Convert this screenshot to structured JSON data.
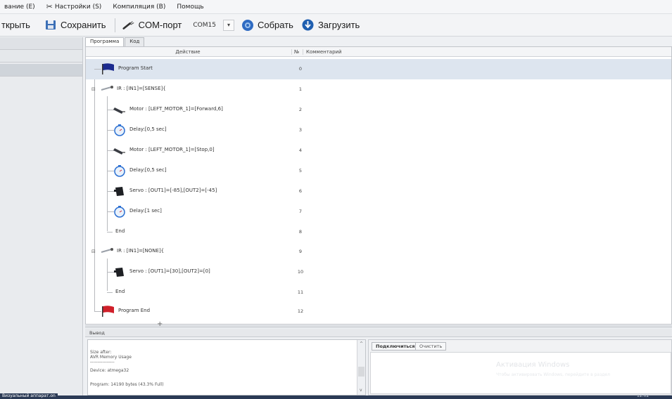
{
  "menu": {
    "edit_label": "вание (E)",
    "settings_label": "Настройки (S)",
    "compile_label": "Компиляция (B)",
    "help_label": "Помощь"
  },
  "toolbar": {
    "open_label": "ткрыть",
    "save_label": "Сохранить",
    "port_label": "COM-порт",
    "port_value": "COM15",
    "build_label": "Собрать",
    "upload_label": "Загрузить"
  },
  "tabs": [
    "Программа",
    "Код"
  ],
  "table": {
    "col_action": "Действие",
    "col_num": "№",
    "col_comment": "Комментарий"
  },
  "program": [
    {
      "label": "Program Start",
      "num": "0",
      "icon": "flag-blue-icon"
    },
    {
      "label": "IR : [IN1]=[SENSE]{",
      "num": "1",
      "icon": "ir-sensor-icon"
    },
    {
      "label": "Motor : [LEFT_MOTOR_1]=[Forward,6]",
      "num": "2",
      "icon": "motor-icon"
    },
    {
      "label": "Delay:[0,5 sec]",
      "num": "3",
      "icon": "stopwatch-icon"
    },
    {
      "label": "Motor : [LEFT_MOTOR_1]=[Stop,0]",
      "num": "4",
      "icon": "motor-icon"
    },
    {
      "label": "Delay:[0,5 sec]",
      "num": "5",
      "icon": "stopwatch-icon"
    },
    {
      "label": "Servo : [OUT1]=[-85],[OUT2]=[-45]",
      "num": "6",
      "icon": "servo-icon"
    },
    {
      "label": "Delay:[1 sec]",
      "num": "7",
      "icon": "stopwatch-icon"
    },
    {
      "label": "End",
      "num": "8",
      "icon": ""
    },
    {
      "label": "IR : [IN1]=[NONE]{",
      "num": "9",
      "icon": "ir-sensor-icon"
    },
    {
      "label": "Servo : [OUT1]=[30],[OUT2]=[0]",
      "num": "10",
      "icon": "servo-icon"
    },
    {
      "label": "End",
      "num": "11",
      "icon": ""
    },
    {
      "label": "Program End",
      "num": "12",
      "icon": "flag-red-icon"
    }
  ],
  "output": {
    "title": "Вывод",
    "lines": [
      "Size after:",
      "AVR Memory Usage",
      "----------------",
      "Device: atmega32",
      "",
      "Program:   14190 bytes (43.3% Full)"
    ]
  },
  "serial": {
    "connect_label": "Подключиться",
    "clear_label": "Очистить",
    "watermark_title": "Активация Windows",
    "watermark_sub": "Чтобы активировать Windows, перейдите в раздел"
  },
  "status": {
    "left_text": "Визуальный аппарат.on",
    "clock": "12:02"
  },
  "colors": {
    "selected_row": "#dde5ef",
    "flag_blue": "#1c2b8f",
    "flag_red": "#d0202a",
    "taskbar": "#2b3a55"
  }
}
